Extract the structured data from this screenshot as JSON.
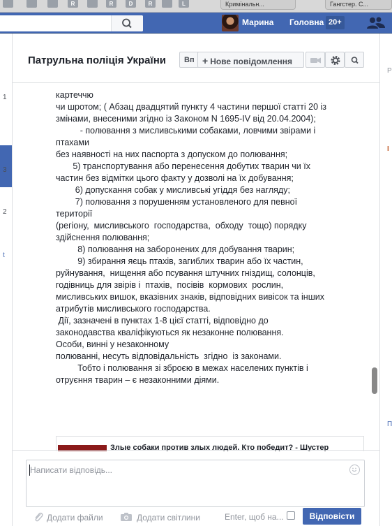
{
  "browser": {
    "favicons": [
      "",
      "",
      "",
      "R",
      "",
      "R",
      "D",
      "R",
      "",
      "L"
    ],
    "tabs": [
      "Кримінальн...",
      "Гангстер. С..."
    ]
  },
  "topbar": {
    "user_name": "Марина",
    "home_label": "Головна",
    "home_count": "20+"
  },
  "thread": {
    "title": "Патрульна поліція України",
    "view_btn": "Вп",
    "new_message": "Нове повідомлення"
  },
  "message": {
    "lines": [
      "картеччю",
      "чи шротом; ( Абзац двадцятий пункту 4 частини першої статті 20 із",
      "змінами, внесеними згідно із Законом N 1695-IV від 20.04.2004);",
      "          - полювання з мисливськими собаками, ловчими звірами і птахами",
      "без наявності на них паспорта з допуском до полювання;",
      "       5) транспортування або перенесення добутих тварин чи їх",
      "частин без відмітки цього факту у дозволі на їх добування;",
      "        6) допускання собак у мисливські угіддя без нагляду;",
      "        7) полювання з порушенням установленого для певної території",
      "(регіону,  мисливського  господарства,  обходу  тощо) порядку",
      "здійснення полювання;",
      "         8) полювання на заборонених для добування тварин;",
      "         9) збирання яєць птахів, загиблих тварин або їх частин,",
      "руйнування,  нищення або псування штучних гніздищ, солонців,",
      "годівниць для звірів і  птахів,  посівів  кормових  рослин,",
      "мисливських вишок, вказівних знаків, відповідних вивісок та інших",
      "атрибутів мисливського господарства.",
      " Дії, зазначені в пунктах 1-8 цієї статті, відповідно до",
      "законодавства кваліфікуються як незаконне полювання.",
      "Особи, винні у незаконному",
      "полюванні, несуть відповідальність  згідно  із законами.",
      "         Тобто і полювання зі зброєю в межах населених пунктів і",
      "отруєння тварин – є незаконними діями."
    ],
    "link_preview_title": "Злые собаки против злых людей. Кто победит? - Шустер"
  },
  "composer": {
    "placeholder": "Написати відповідь...",
    "add_files": "Додати файли",
    "add_photos": "Додати світлини",
    "enter_label": "Enter, щоб на...",
    "send": "Відповісти"
  },
  "left_marks": [
    "1",
    "4",
    "3",
    "2",
    "t"
  ],
  "right_marks": [
    "P",
    "I",
    "П"
  ]
}
